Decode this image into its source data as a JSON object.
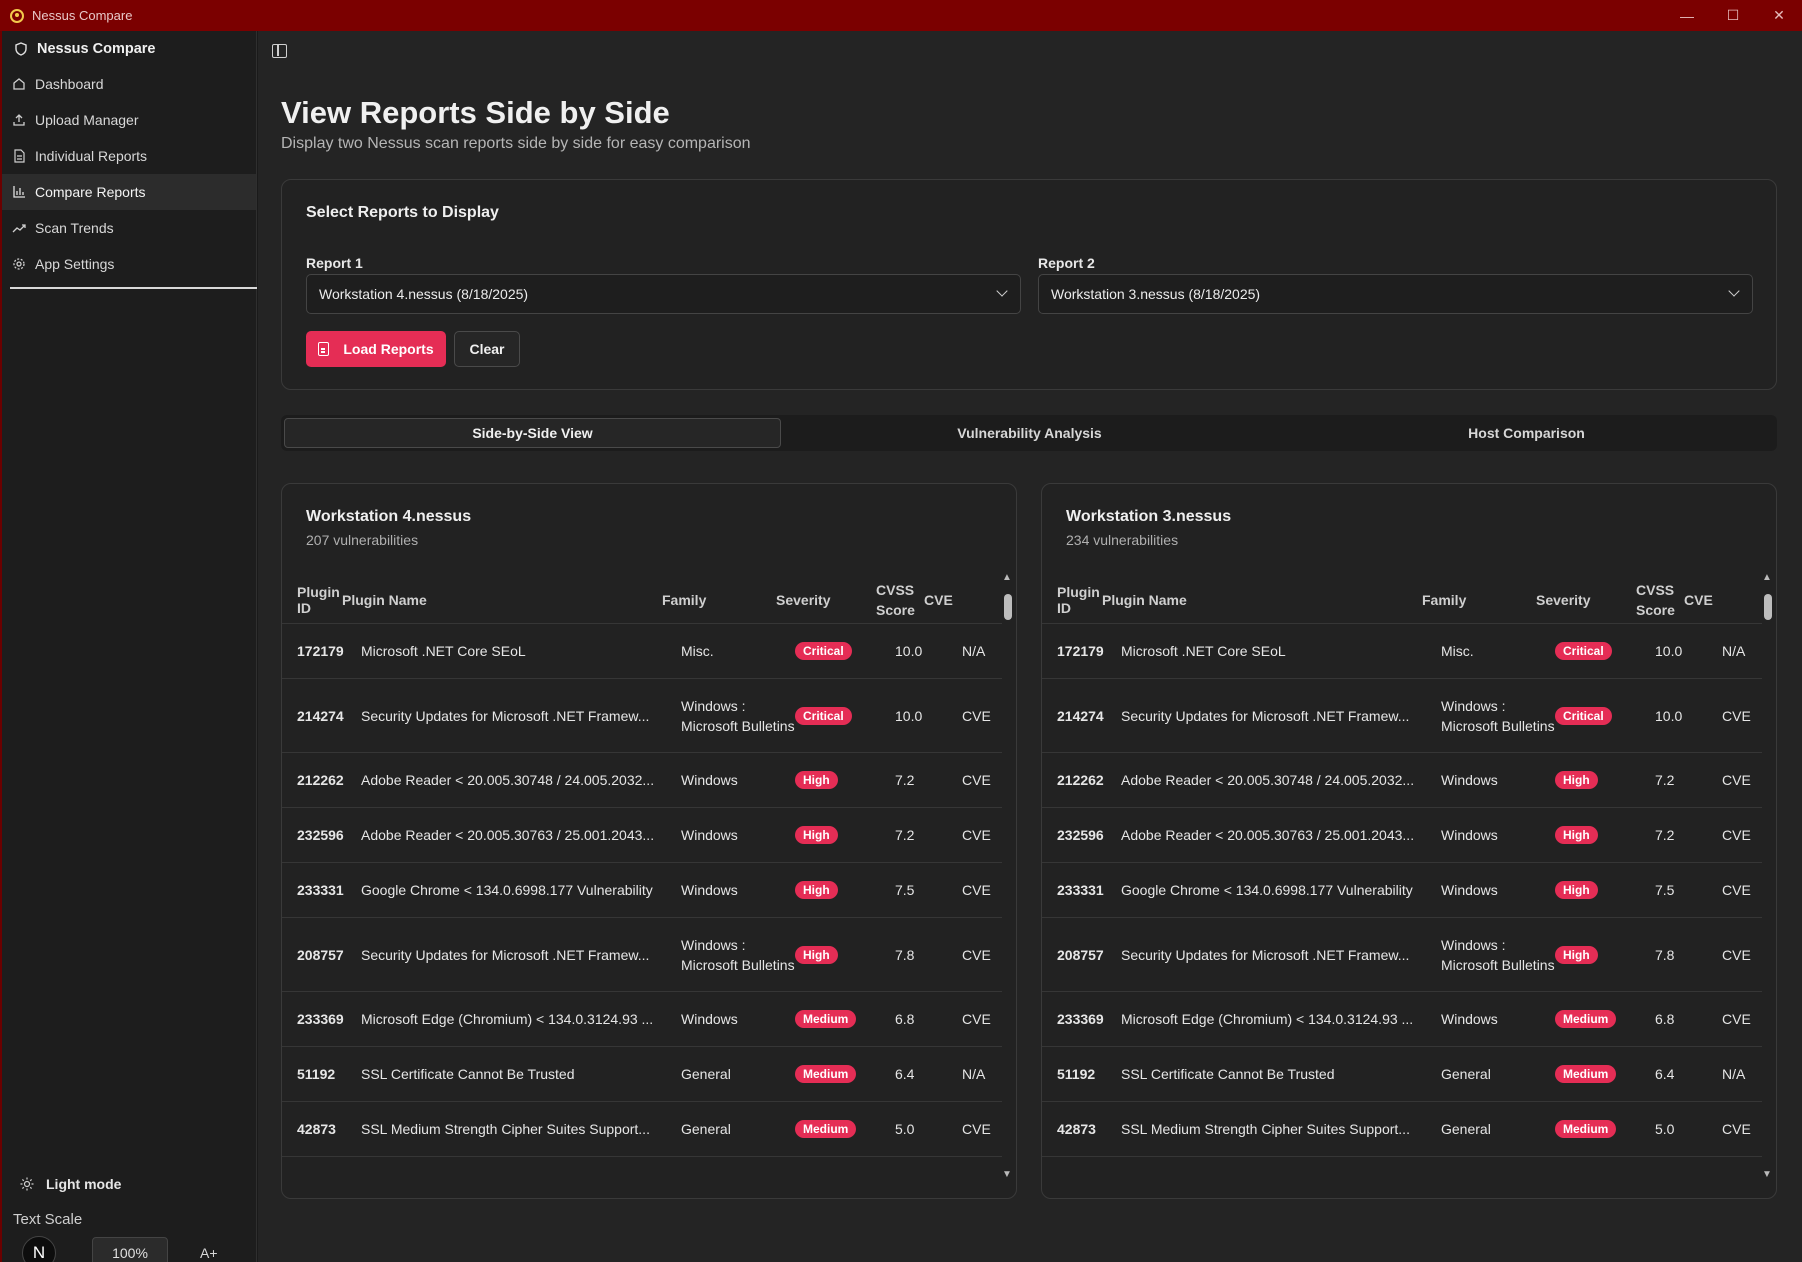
{
  "window": {
    "title": "Nessus Compare",
    "controls": [
      "—",
      "☐",
      "✕"
    ]
  },
  "sidebar": {
    "brand": "Nessus Compare",
    "items": [
      {
        "label": "Dashboard",
        "icon": "home-icon"
      },
      {
        "label": "Upload Manager",
        "icon": "upload-icon"
      },
      {
        "label": "Individual Reports",
        "icon": "document-icon"
      },
      {
        "label": "Compare Reports",
        "icon": "bar-chart-icon",
        "active": true
      },
      {
        "label": "Scan Trends",
        "icon": "trend-icon"
      },
      {
        "label": "App Settings",
        "icon": "gear-icon"
      }
    ],
    "mode_label": "Light mode",
    "text_scale_label": "Text Scale",
    "scale_reset": "N",
    "scale_value": "100%",
    "scale_increase": "A+"
  },
  "header": {
    "title": "View Reports Side by Side",
    "subtitle": "Display two Nessus scan reports side by side for easy comparison"
  },
  "select": {
    "title": "Select Reports to Display",
    "report1_label": "Report 1",
    "report1_value": "Workstation 4.nessus (8/18/2025)",
    "report2_label": "Report 2",
    "report2_value": "Workstation 3.nessus (8/18/2025)",
    "load_label": "Load Reports",
    "clear_label": "Clear"
  },
  "tabs": [
    {
      "label": "Side-by-Side View",
      "active": true
    },
    {
      "label": "Vulnerability Analysis"
    },
    {
      "label": "Host Comparison"
    }
  ],
  "columns": [
    "Plugin ID",
    "Plugin Name",
    "Family",
    "Severity",
    "CVSS Score",
    "CVE"
  ],
  "colors": {
    "accent": "#e52d55",
    "titlebar": "#7b0000"
  },
  "reports": [
    {
      "title": "Workstation 4.nessus",
      "count": "207 vulnerabilities",
      "rows": [
        {
          "id": "172179",
          "name": "Microsoft .NET Core SEoL",
          "family": "Misc.",
          "severity": "Critical",
          "cvss": "10.0",
          "cve": "N/A"
        },
        {
          "id": "214274",
          "name": "Security Updates for Microsoft .NET Framew...",
          "family": "Windows : Microsoft Bulletins",
          "severity": "Critical",
          "cvss": "10.0",
          "cve": "CVE"
        },
        {
          "id": "212262",
          "name": "Adobe Reader < 20.005.30748 / 24.005.2032...",
          "family": "Windows",
          "severity": "High",
          "cvss": "7.2",
          "cve": "CVE"
        },
        {
          "id": "232596",
          "name": "Adobe Reader < 20.005.30763 / 25.001.2043...",
          "family": "Windows",
          "severity": "High",
          "cvss": "7.2",
          "cve": "CVE"
        },
        {
          "id": "233331",
          "name": "Google Chrome < 134.0.6998.177 Vulnerability",
          "family": "Windows",
          "severity": "High",
          "cvss": "7.5",
          "cve": "CVE"
        },
        {
          "id": "208757",
          "name": "Security Updates for Microsoft .NET Framew...",
          "family": "Windows : Microsoft Bulletins",
          "severity": "High",
          "cvss": "7.8",
          "cve": "CVE"
        },
        {
          "id": "233369",
          "name": "Microsoft Edge (Chromium) < 134.0.3124.93 ...",
          "family": "Windows",
          "severity": "Medium",
          "cvss": "6.8",
          "cve": "CVE"
        },
        {
          "id": "51192",
          "name": "SSL Certificate Cannot Be Trusted",
          "family": "General",
          "severity": "Medium",
          "cvss": "6.4",
          "cve": "N/A"
        },
        {
          "id": "42873",
          "name": "SSL Medium Strength Cipher Suites Support...",
          "family": "General",
          "severity": "Medium",
          "cvss": "5.0",
          "cve": "CVE"
        }
      ]
    },
    {
      "title": "Workstation 3.nessus",
      "count": "234 vulnerabilities",
      "rows": [
        {
          "id": "172179",
          "name": "Microsoft .NET Core SEoL",
          "family": "Misc.",
          "severity": "Critical",
          "cvss": "10.0",
          "cve": "N/A"
        },
        {
          "id": "214274",
          "name": "Security Updates for Microsoft .NET Framew...",
          "family": "Windows : Microsoft Bulletins",
          "severity": "Critical",
          "cvss": "10.0",
          "cve": "CVE"
        },
        {
          "id": "212262",
          "name": "Adobe Reader < 20.005.30748 / 24.005.2032...",
          "family": "Windows",
          "severity": "High",
          "cvss": "7.2",
          "cve": "CVE"
        },
        {
          "id": "232596",
          "name": "Adobe Reader < 20.005.30763 / 25.001.2043...",
          "family": "Windows",
          "severity": "High",
          "cvss": "7.2",
          "cve": "CVE"
        },
        {
          "id": "233331",
          "name": "Google Chrome < 134.0.6998.177 Vulnerability",
          "family": "Windows",
          "severity": "High",
          "cvss": "7.5",
          "cve": "CVE"
        },
        {
          "id": "208757",
          "name": "Security Updates for Microsoft .NET Framew...",
          "family": "Windows : Microsoft Bulletins",
          "severity": "High",
          "cvss": "7.8",
          "cve": "CVE"
        },
        {
          "id": "233369",
          "name": "Microsoft Edge (Chromium) < 134.0.3124.93 ...",
          "family": "Windows",
          "severity": "Medium",
          "cvss": "6.8",
          "cve": "CVE"
        },
        {
          "id": "51192",
          "name": "SSL Certificate Cannot Be Trusted",
          "family": "General",
          "severity": "Medium",
          "cvss": "6.4",
          "cve": "N/A"
        },
        {
          "id": "42873",
          "name": "SSL Medium Strength Cipher Suites Support...",
          "family": "General",
          "severity": "Medium",
          "cvss": "5.0",
          "cve": "CVE"
        }
      ]
    }
  ]
}
